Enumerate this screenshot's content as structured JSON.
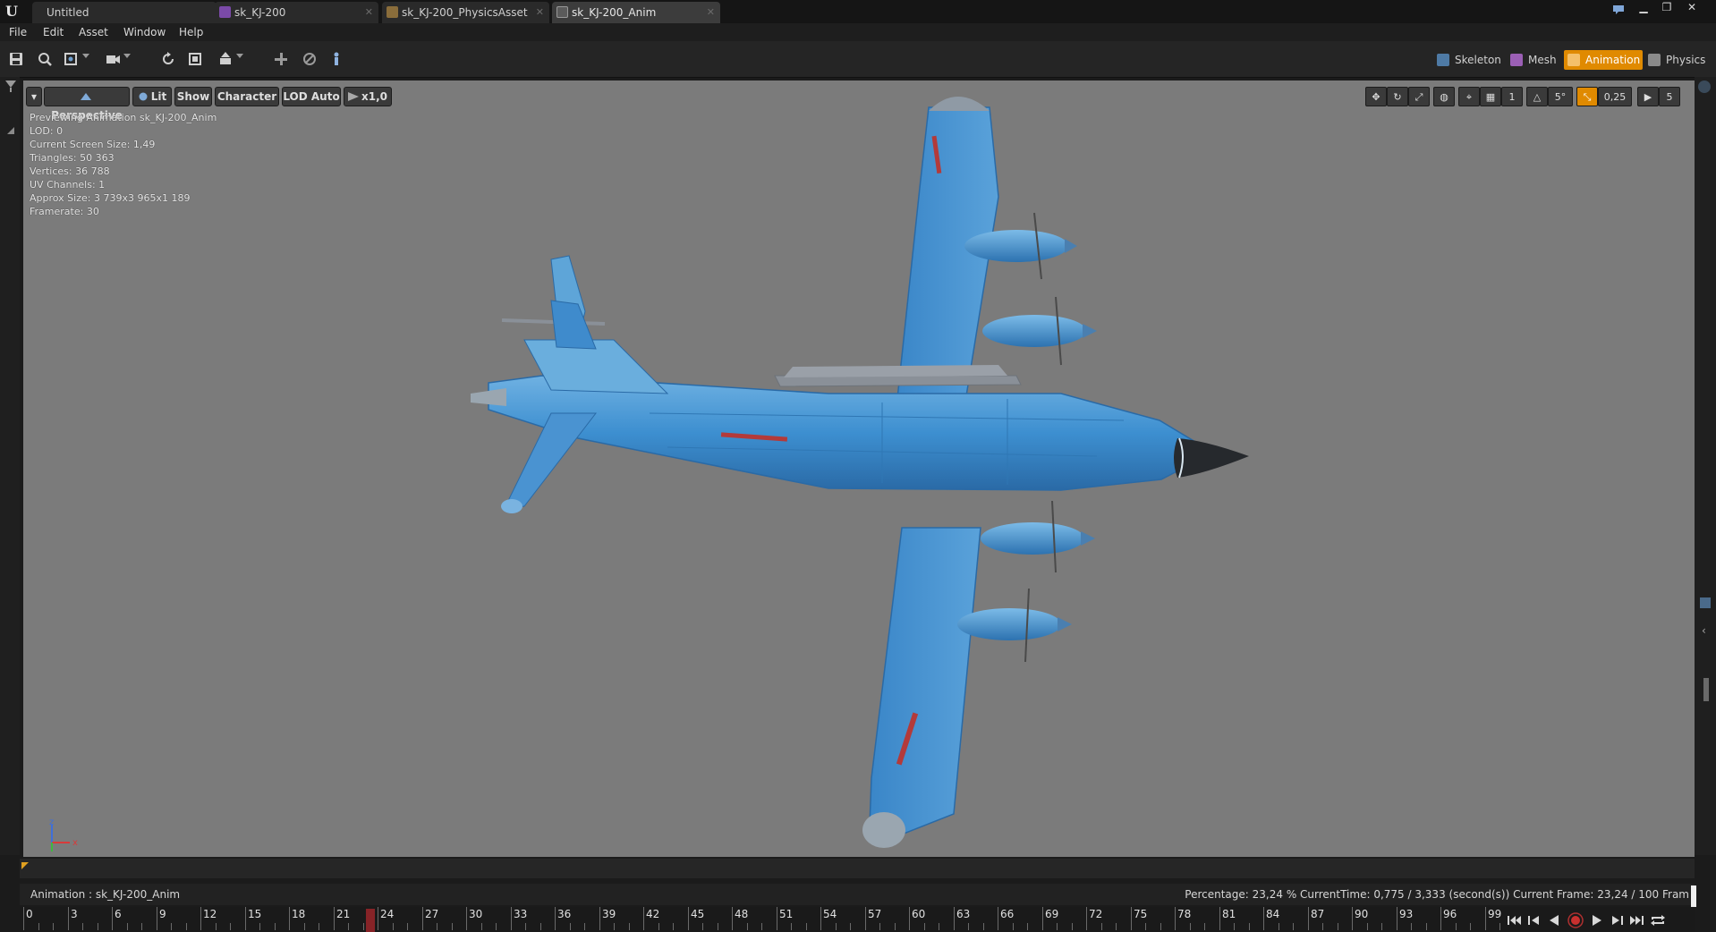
{
  "app": {
    "logo": "U"
  },
  "tabs": [
    {
      "label": "Untitled",
      "icon": "none"
    },
    {
      "label": "sk_KJ-200",
      "icon": "skeletal-mesh-icon"
    },
    {
      "label": "sk_KJ-200_PhysicsAsset",
      "icon": "physics-asset-icon"
    },
    {
      "label": "sk_KJ-200_Anim",
      "icon": "animation-icon"
    }
  ],
  "menu": [
    "File",
    "Edit",
    "Asset",
    "Window",
    "Help"
  ],
  "modes": {
    "skeleton": "Skeleton",
    "mesh": "Mesh",
    "animation": "Animation",
    "physics": "Physics",
    "active": "Animation"
  },
  "viewport": {
    "perspective": "Perspective",
    "lit": "Lit",
    "show": "Show",
    "character": "Character",
    "lod": "LOD Auto",
    "speed": "x1,0",
    "snap_grid": "1",
    "snap_rotation": "5°",
    "snap_scale": "0,25",
    "camera_speed": "5",
    "stats": [
      "Previewing Animation sk_KJ-200_Anim",
      "LOD: 0",
      "Current Screen Size: 1,49",
      "Triangles: 50 363",
      "Vertices: 36 788",
      "UV Channels: 1",
      "Approx Size: 3 739x3 965x1 189",
      "Framerate: 30"
    ],
    "axis_x": "x",
    "axis_z": "z"
  },
  "timeline": {
    "animation_label": "Animation :  sk_KJ-200_Anim",
    "readout": "Percentage:  23,24 %  CurrentTime:  0,775 / 3,333 (second(s))  Current Frame:  23,24 / 100 Fram",
    "ticks": [
      "0",
      "3",
      "6",
      "9",
      "12",
      "15",
      "18",
      "21",
      "24",
      "27",
      "30",
      "33",
      "36",
      "39",
      "42",
      "45",
      "48",
      "51",
      "54",
      "57",
      "60",
      "63",
      "66",
      "69",
      "72",
      "75",
      "78",
      "81",
      "84",
      "87",
      "90",
      "93",
      "96",
      "99"
    ],
    "current_frame": 23.24,
    "total_frames": 100
  },
  "colors": {
    "accent": "#e08a00",
    "viewport_bg": "#7b7b7b",
    "aircraft": "#3d8fd0",
    "playhead": "#a3262a"
  }
}
